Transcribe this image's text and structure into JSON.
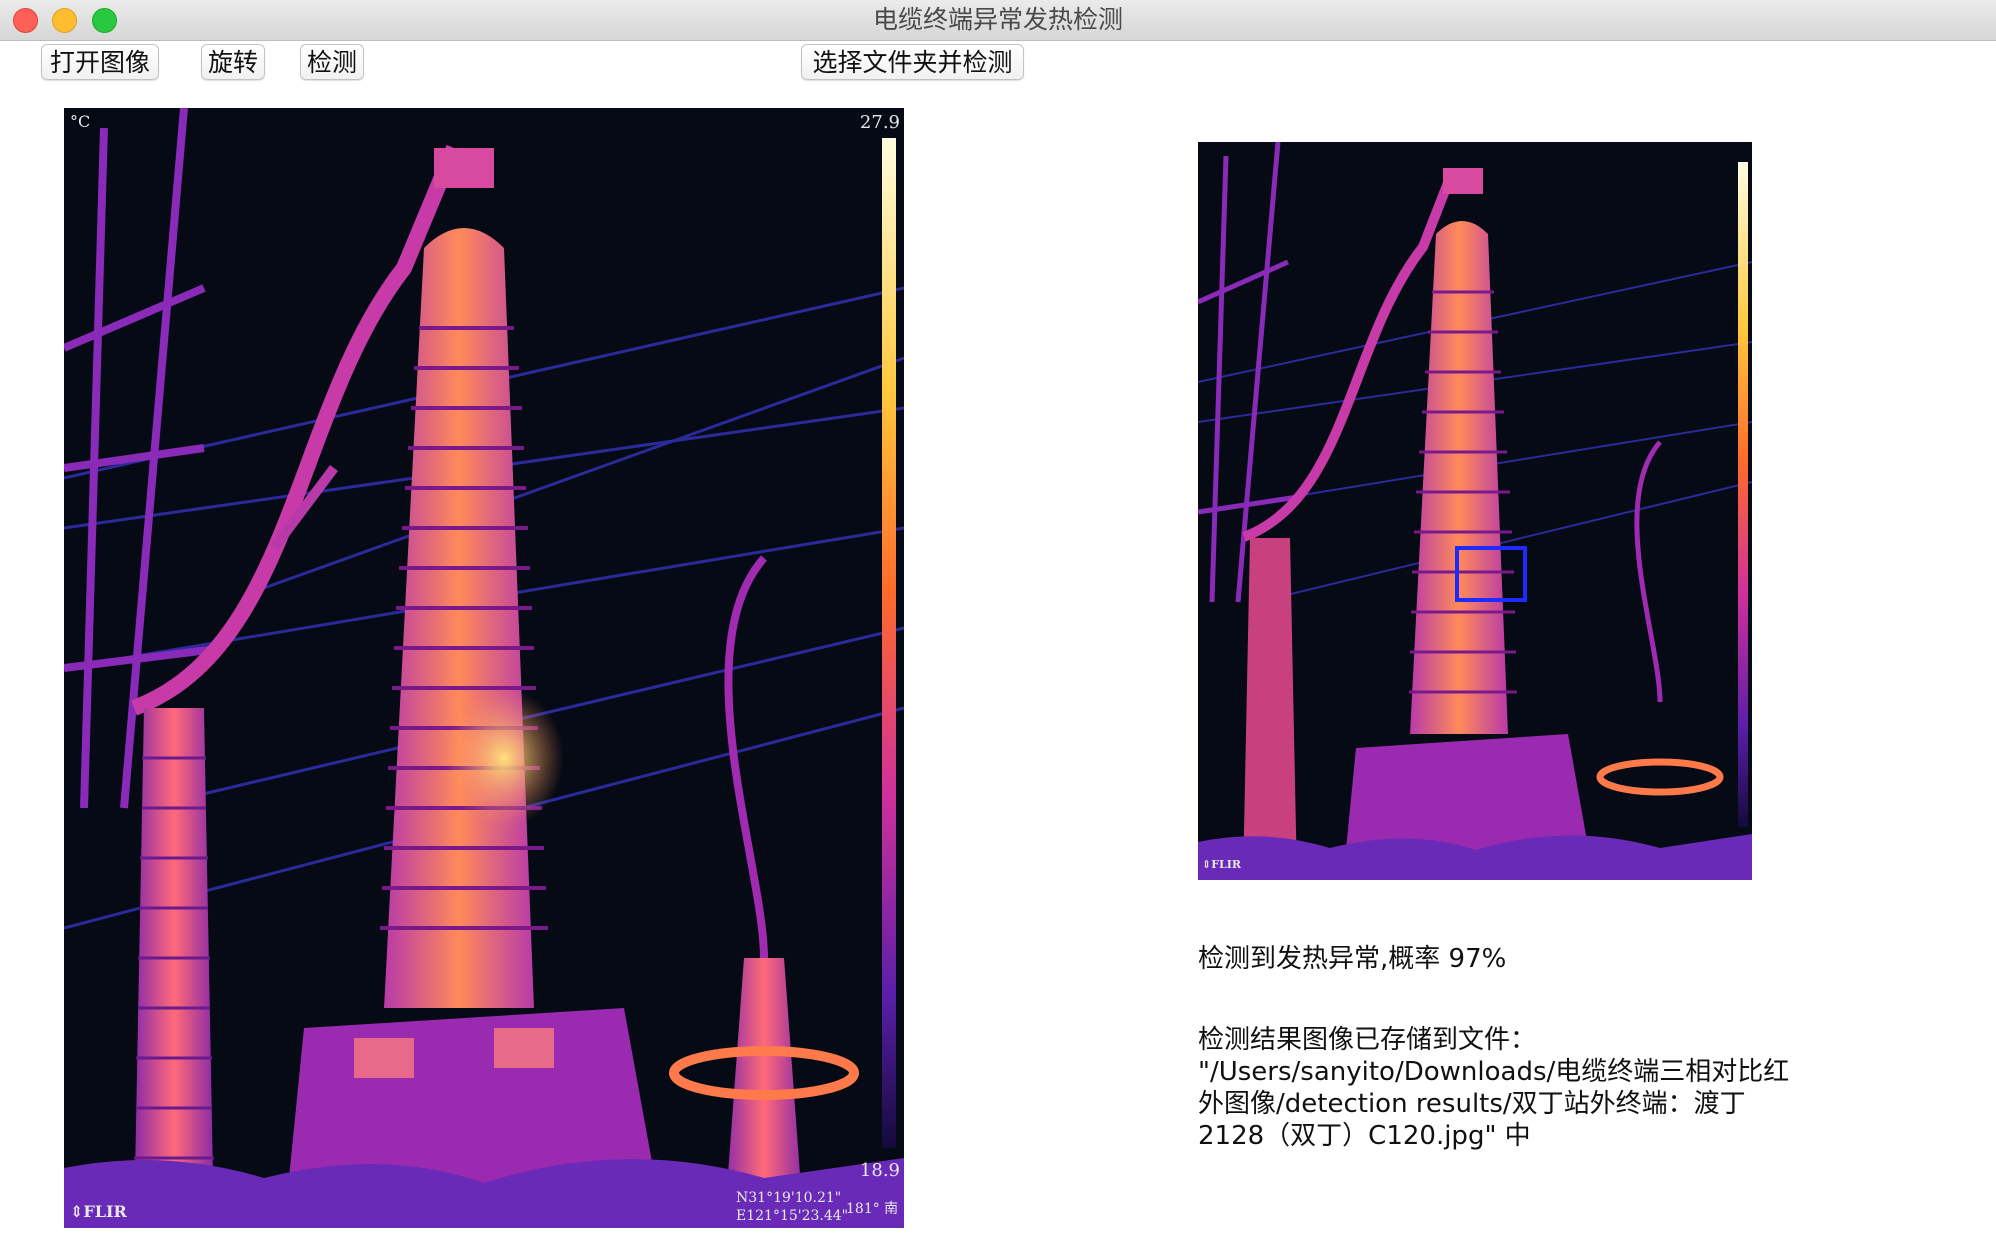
{
  "window": {
    "title": "电缆终端异常发热检测"
  },
  "toolbar": {
    "open_label": "打开图像",
    "rotate_label": "旋转",
    "detect_label": "检测",
    "folder_label": "选择文件夹并检测"
  },
  "left_image": {
    "unit": "°C",
    "max_temp": "27.9",
    "min_temp": "18.9",
    "brand": "⇕FLIR",
    "gps_lat": "N31°19'10.21\"",
    "gps_lon": "E121°15'23.44\"",
    "compass": "181° 南"
  },
  "right_image": {
    "brand": "⇕FLIR",
    "detection_box": {
      "color": "#1e2bff"
    }
  },
  "result": {
    "probability_text": "检测到发热异常,概率 97%",
    "saved_line1": "检测结果图像已存储到文件：",
    "saved_line2": " \"/Users/sanyito/Downloads/电缆终端三相对比红",
    "saved_line3": "外图像/detection results/双丁站外终端：渡丁",
    "saved_line4": "2128（双丁）C120.jpg\" 中"
  },
  "colors": {
    "hot": "#ffd27a",
    "warm": "#ff7a3c",
    "mid": "#d94aa8",
    "cool": "#6a34c8",
    "background": "#050a14"
  }
}
